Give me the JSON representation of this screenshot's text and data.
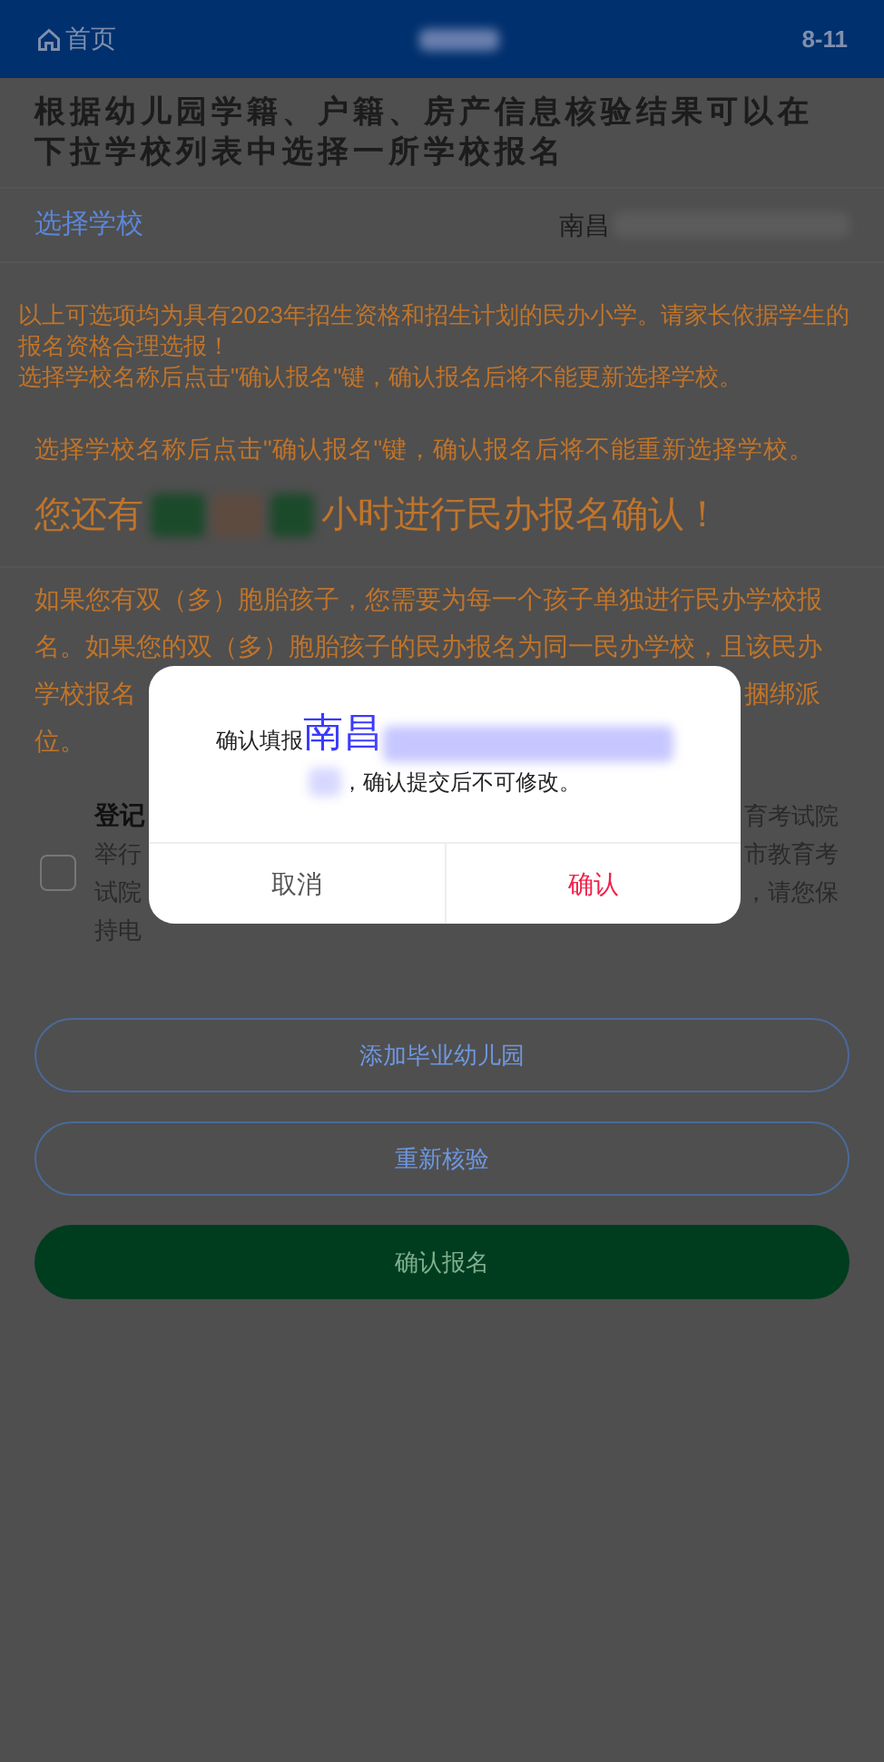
{
  "header": {
    "home": "首页",
    "time": "8-11"
  },
  "intro": "根据幼儿园学籍、户籍、房产信息核验结果可以在下拉学校列表中选择一所学校报名",
  "school_select": {
    "label": "选择学校",
    "value": "南昌"
  },
  "notice_lines": [
    "以上可选项均为具有2023年招生资格和招生计划的民办小学。请家长依据学生的报名资格合理选报！",
    "选择学校名称后点击\"确认报名\"键，确认报名后将不能更新选择学校。"
  ],
  "reminder": "选择学校名称后点击\"确认报名\"键，确认报名后将不能重新选择学校。",
  "countdown": {
    "before": "您还有",
    "after": "小时进行民办报名确认！"
  },
  "twins_lines": [
    {
      "left": "如果您有双（多）胞胎孩子，您需要为每一个孩子单独进行民办学校报"
    },
    {
      "left": "名。如果您的双（多）胞胎孩子的民办报名为同一民办学校，且该民办"
    },
    {
      "left": "学校报名",
      "right": "捆绑派"
    },
    {
      "left": "位。"
    }
  ],
  "agreement": {
    "checked": false,
    "lines": [
      {
        "left": "登记",
        "right": "育考试院"
      },
      {
        "left": "举行",
        "right": "市教育考"
      },
      {
        "left": "试院",
        "right": "，请您保"
      },
      {
        "left": "持电"
      }
    ]
  },
  "buttons": [
    {
      "label": "添加毕业幼儿园",
      "kind": "outline"
    },
    {
      "label": "重新核验",
      "kind": "outline"
    },
    {
      "label": "确认报名",
      "kind": "primary"
    }
  ],
  "dialog": {
    "prefix": "确认填报",
    "school": "南昌",
    "suffix": "，确认提交后不可修改。",
    "cancel": "取消",
    "confirm": "确认"
  }
}
